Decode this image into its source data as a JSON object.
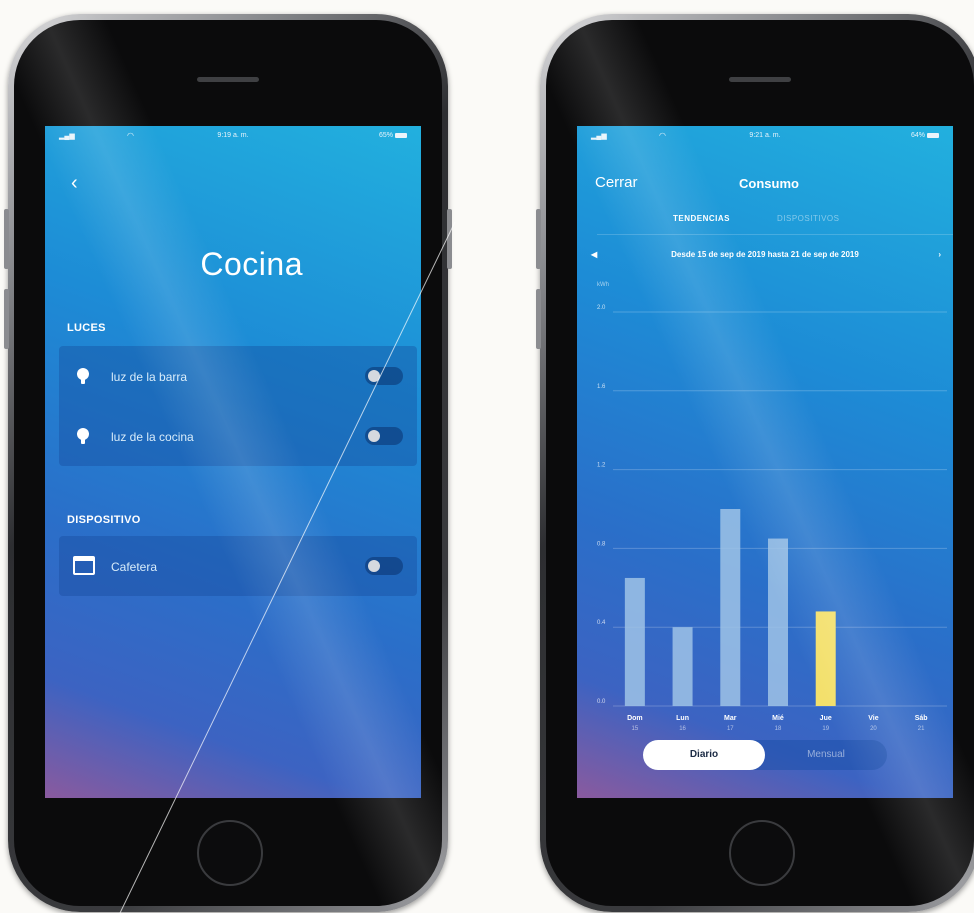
{
  "left_phone": {
    "status": {
      "time": "9:19 a. m.",
      "battery": "65%"
    },
    "room_title": "Cocina",
    "sections": [
      {
        "label": "LUCES",
        "devices": [
          {
            "name": "luz de la barra",
            "icon": "bulb-icon",
            "on": false
          },
          {
            "name": "luz de la cocina",
            "icon": "bulb-icon",
            "on": false
          }
        ]
      },
      {
        "label": "DISPOSITIVO",
        "devices": [
          {
            "name": "Cafetera",
            "icon": "coffee-maker-icon",
            "on": false
          }
        ]
      }
    ]
  },
  "right_phone": {
    "status": {
      "time": "9:21 a. m.",
      "battery": "64%"
    },
    "nav": {
      "close_label": "Cerrar",
      "title": "Consumo"
    },
    "tabs": {
      "active": "TENDENCIAS",
      "inactive": "DISPOSITIVOS"
    },
    "date_range": "Desde 15 de sep de 2019 hasta 21 de sep de 2019",
    "segmented": {
      "active": "Diario",
      "inactive": "Mensual"
    },
    "colors": {
      "bar": "#9fc3e6",
      "bar_highlight": "#f3e06b"
    }
  },
  "chart_data": {
    "type": "bar",
    "categories": [
      "Dom",
      "Lun",
      "Mar",
      "Mié",
      "Jue",
      "Vie",
      "Sáb"
    ],
    "category_days": [
      "15",
      "16",
      "17",
      "18",
      "19",
      "20",
      "21"
    ],
    "values": [
      0.65,
      0.4,
      1.0,
      0.85,
      0.48,
      null,
      null
    ],
    "highlight_index": 4,
    "ylabel": "kWh",
    "yticks": [
      "0.0",
      "0.4",
      "0.8",
      "1.2",
      "1.6",
      "2.0"
    ],
    "ylim": [
      0,
      2.0
    ],
    "grid": true
  }
}
